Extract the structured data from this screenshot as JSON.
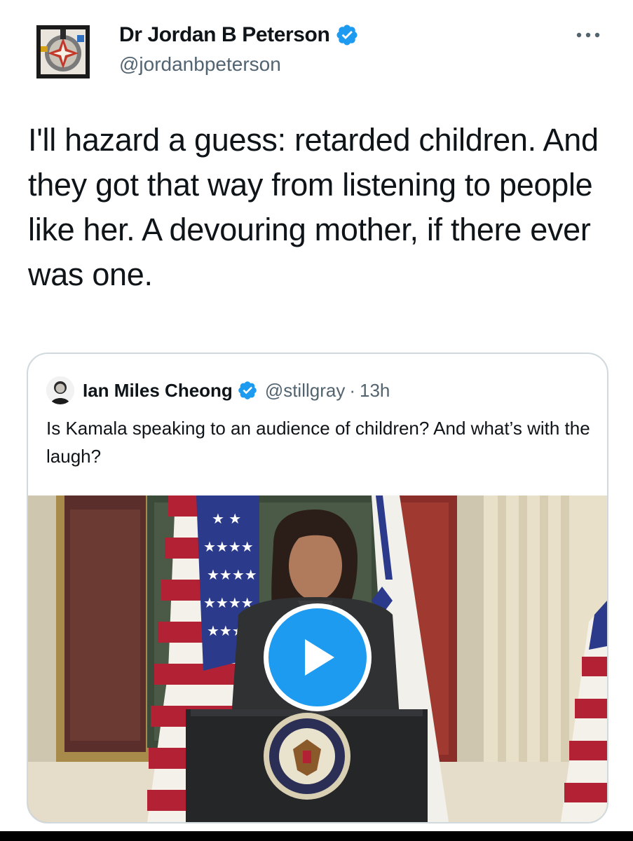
{
  "author": {
    "name": "Dr Jordan B Peterson",
    "handle": "@jordanbpeterson",
    "verified": true
  },
  "tweet": {
    "text": "I'll hazard a guess:  retarded children. And they got that way from listening to people like her. A devouring mother, if there ever was one."
  },
  "quoted_tweet": {
    "author_name": "Ian Miles Cheong",
    "handle": "@stillgray",
    "separator": "·",
    "time": "13h",
    "text": "Is Kamala speaking to an audience of children? And what’s with the laugh?",
    "media": {
      "type": "video",
      "play_icon": "play-icon"
    }
  },
  "colors": {
    "accent": "#1d9bf0",
    "text_primary": "#0f1419",
    "text_secondary": "#536471",
    "border": "#cfd9de"
  }
}
